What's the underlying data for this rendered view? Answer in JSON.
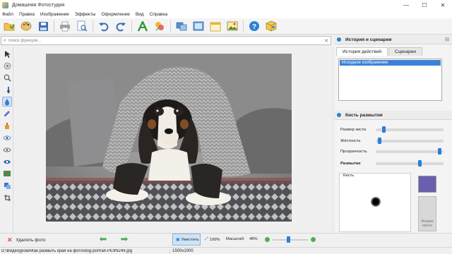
{
  "window": {
    "title": "Домашняя Фотостудия",
    "controls": {
      "minimize": "—",
      "maximize": "☐",
      "close": "✕"
    }
  },
  "menu": [
    "Файл",
    "Правка",
    "Изображение",
    "Эффекты",
    "Оформление",
    "Вид",
    "Справка"
  ],
  "toolbar": {
    "icons": [
      "open-folder-icon",
      "palette-icon",
      "save-icon",
      "print-icon",
      "print-preview-icon",
      "undo-icon",
      "redo-icon",
      "text-icon",
      "color-effects-icon",
      "image-compare-icon",
      "image-frame-icon",
      "calendar-icon",
      "image-icon",
      "help-icon",
      "package-icon"
    ]
  },
  "search": {
    "placeholder": "поиск функций...",
    "value": ""
  },
  "left_tools": [
    "pointer-icon",
    "target-icon",
    "zoom-icon",
    "brush-icon",
    "blur-drop-icon",
    "pencil-icon",
    "bottle-icon",
    "eye-icon",
    "eye-outline-icon",
    "eye-filled-icon",
    "red-eye-icon",
    "clone-icon",
    "crop-icon"
  ],
  "right_panel": {
    "history_title": "История и сценарии",
    "tabs": [
      "История действий",
      "Сценарии"
    ],
    "history_items": [
      "Исходное изображение"
    ],
    "brush_title": "Кисть размытия",
    "sliders": [
      {
        "label": "Размер кисти",
        "value": 0.1,
        "bold": false
      },
      {
        "label": "Жёсткость",
        "value": 0.03,
        "bold": false
      },
      {
        "label": "Прозрачность",
        "value": 0.97,
        "bold": false
      },
      {
        "label": "Размытие",
        "value": 0.66,
        "bold": true
      }
    ],
    "brush_caption": "Кисть",
    "brush_color": "#6a5fae",
    "brush_shape_label": "Форма кисти"
  },
  "bottom": {
    "delete_label": "Удалить фото",
    "fit_label": "Уместить",
    "zoom100_label": "100%",
    "zoom_label": "Масштаб:",
    "zoom_value": "48%",
    "zoom_level": 0.45
  },
  "status": {
    "path": "D:\\Видеоуроки\\Как размыть края на фото\\dog-portrait-PE9N249.jpg",
    "dims": "1500x1000"
  }
}
